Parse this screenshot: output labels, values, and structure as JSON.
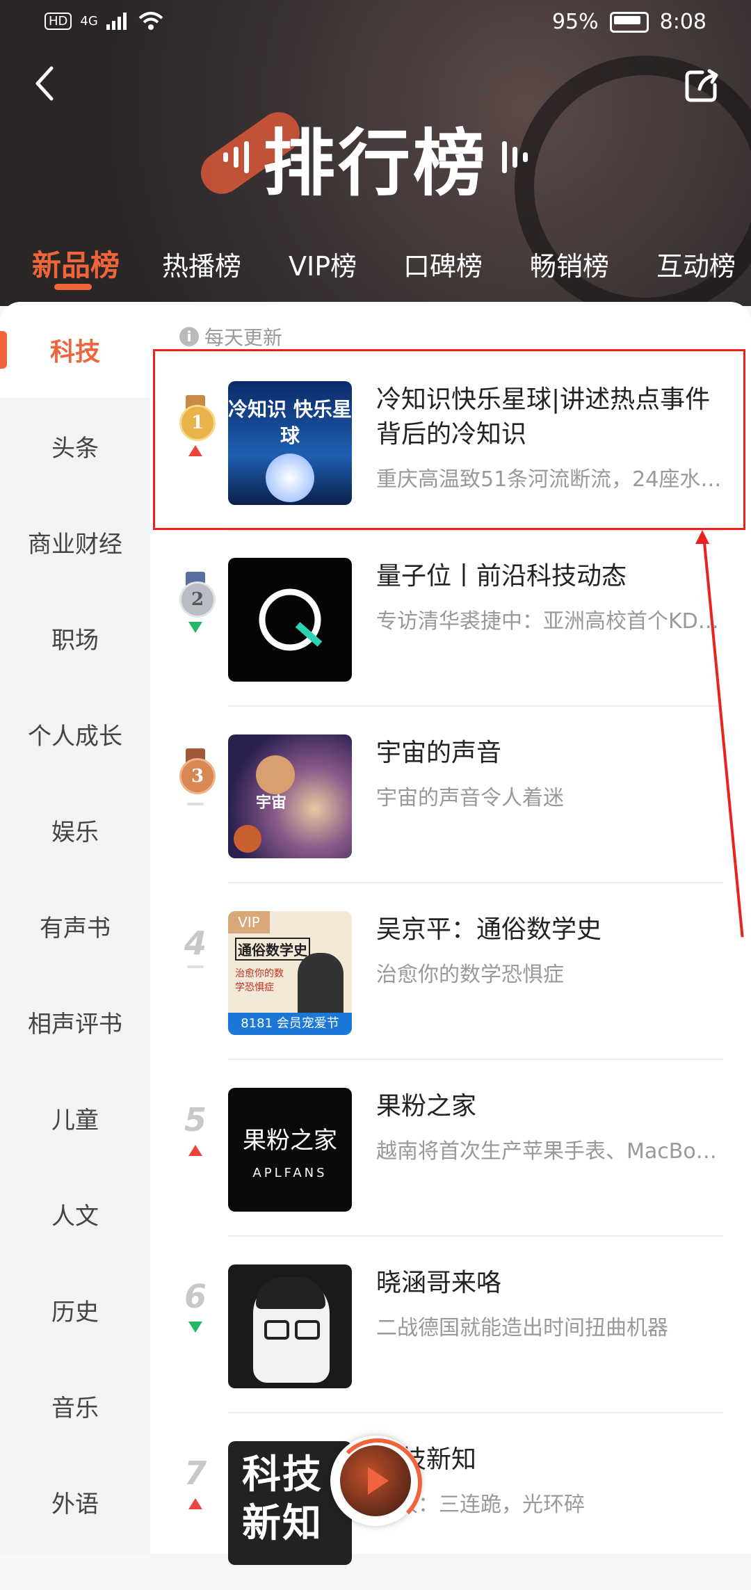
{
  "status_bar": {
    "hd": "HD",
    "network": "4G",
    "battery": "95%",
    "time": "8:08"
  },
  "header": {
    "title": "排行榜"
  },
  "tabs": [
    "新品榜",
    "热播榜",
    "VIP榜",
    "口碑榜",
    "畅销榜",
    "互动榜"
  ],
  "active_tab": "新品榜",
  "update_note": "每天更新",
  "categories": [
    "科技",
    "头条",
    "商业财经",
    "职场",
    "个人成长",
    "娱乐",
    "有声书",
    "相声评书",
    "儿童",
    "人文",
    "历史",
    "音乐",
    "外语"
  ],
  "active_category": "科技",
  "items": [
    {
      "rank": "1",
      "trend": "up",
      "title": "冷知识快乐星球|讲述热点事件背后的冷知识",
      "desc": "重庆高温致51条河流断流，24座水…",
      "cover_text": "冷知识 快乐星球"
    },
    {
      "rank": "2",
      "trend": "down",
      "title": "量子位丨前沿科技动态",
      "desc": "专访清华裘捷中：亚洲高校首个KD…",
      "cover_text": ""
    },
    {
      "rank": "3",
      "trend": "flat",
      "title": "宇宙的声音",
      "desc": "宇宙的声音令人着迷",
      "cover_text": "宇宙"
    },
    {
      "rank": "4",
      "trend": "flat",
      "title": "吴京平：通俗数学史",
      "desc": "治愈你的数学恐惧症",
      "cover_text": "通俗数学史",
      "cover_badge": "VIP",
      "cover_sub": "治愈你的数学恐惧症",
      "cover_promo": "8181 会员宠爱节"
    },
    {
      "rank": "5",
      "trend": "up",
      "title": "果粉之家",
      "desc": "越南将首次生产苹果手表、MacBo…",
      "cover_text": "果粉之家",
      "cover_sub": "APLFANS"
    },
    {
      "rank": "6",
      "trend": "down",
      "title": "晓涵哥来咯",
      "desc": "二战德国就能造出时间扭曲机器",
      "cover_text": ""
    },
    {
      "rank": "7",
      "trend": "up",
      "title": "科技新知",
      "desc": "财报：三连跪，光环碎",
      "cover_text": "科技新知"
    }
  ],
  "colors": {
    "accent": "#f0643c",
    "highlight": "#e8221e",
    "up": "#e8453c",
    "down": "#25b864"
  }
}
